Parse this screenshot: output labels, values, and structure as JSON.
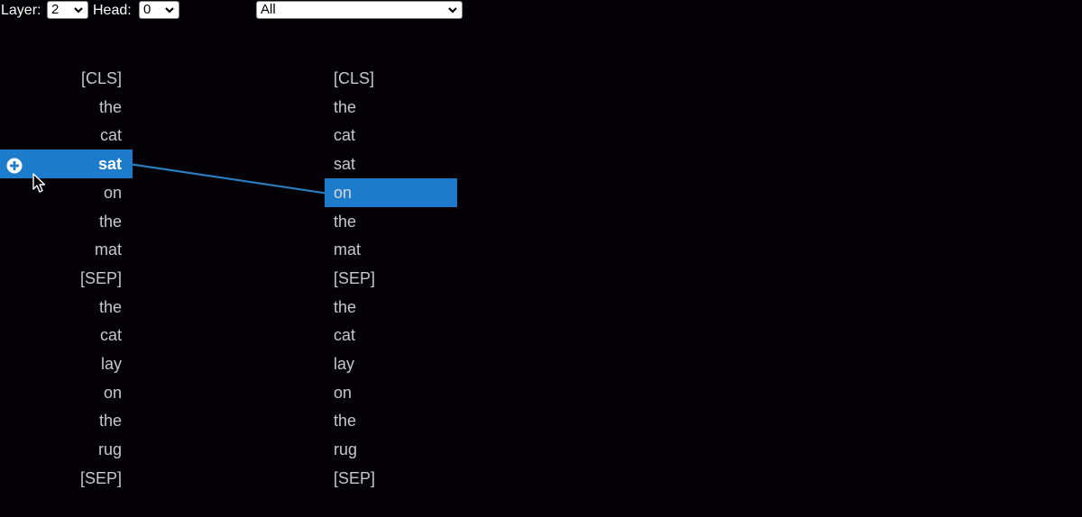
{
  "controls": {
    "layer_label": "Layer:",
    "layer_value": "2",
    "head_label": "Head:",
    "head_value": "0",
    "filter_value": "All"
  },
  "left_tokens": [
    "[CLS]",
    "the",
    "cat",
    "sat",
    "on",
    "the",
    "mat",
    "[SEP]",
    "the",
    "cat",
    "lay",
    "on",
    "the",
    "rug",
    "[SEP]"
  ],
  "right_tokens": [
    "[CLS]",
    "the",
    "cat",
    "sat",
    "on",
    "the",
    "mat",
    "[SEP]",
    "the",
    "cat",
    "lay",
    "on",
    "the",
    "rug",
    "[SEP]"
  ],
  "selected_left_index": 3,
  "selected_right_index": 4,
  "colors": {
    "background": "#030105",
    "highlight": "#1d7bcc",
    "attention_line": "#2b7bbd",
    "token_text": "#c8c8c8"
  },
  "icons": {
    "expand": "plus-circle-icon",
    "cursor": "mouse-pointer-icon"
  }
}
